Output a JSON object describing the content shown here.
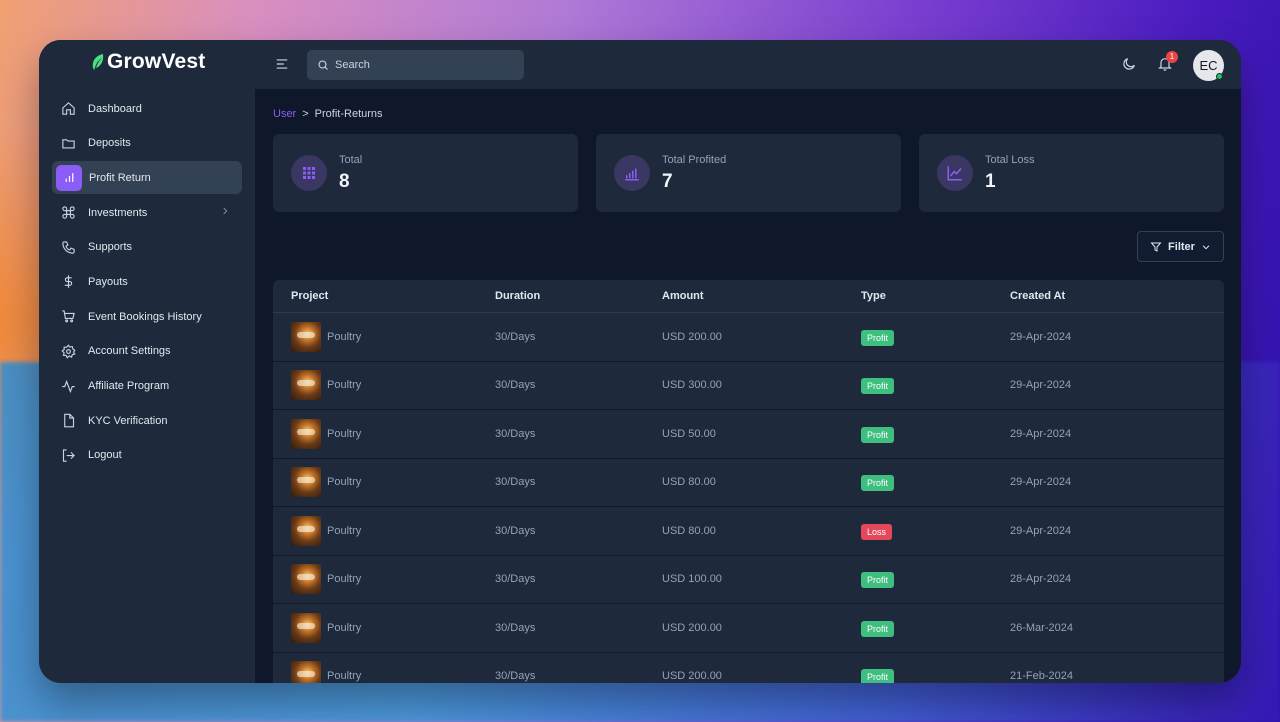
{
  "brand": {
    "name": "GrowVest"
  },
  "search": {
    "placeholder": "Search"
  },
  "header": {
    "notification_count": "1",
    "avatar_initials": "EC"
  },
  "sidebar": {
    "items": [
      {
        "label": "Dashboard",
        "icon": "home-icon"
      },
      {
        "label": "Deposits",
        "icon": "folder-icon"
      },
      {
        "label": "Profit Return",
        "icon": "bar-chart-icon",
        "active": true
      },
      {
        "label": "Investments",
        "icon": "command-icon",
        "has_children": true
      },
      {
        "label": "Supports",
        "icon": "phone-icon"
      },
      {
        "label": "Payouts",
        "icon": "dollar-icon"
      },
      {
        "label": "Event Bookings History",
        "icon": "cart-icon"
      },
      {
        "label": "Account Settings",
        "icon": "gear-icon"
      },
      {
        "label": "Affiliate Program",
        "icon": "activity-icon"
      },
      {
        "label": "KYC Verification",
        "icon": "file-icon"
      },
      {
        "label": "Logout",
        "icon": "logout-icon"
      }
    ]
  },
  "breadcrumb": {
    "parent": "User",
    "separator": ">",
    "current": "Profit-Returns"
  },
  "stats": [
    {
      "label": "Total",
      "value": "8",
      "icon": "grid-icon"
    },
    {
      "label": "Total Profited",
      "value": "7",
      "icon": "bar-chart-icon"
    },
    {
      "label": "Total Loss",
      "value": "1",
      "icon": "line-chart-icon"
    }
  ],
  "filter": {
    "label": "Filter"
  },
  "table": {
    "columns": [
      "Project",
      "Duration",
      "Amount",
      "Type",
      "Created At"
    ],
    "rows": [
      {
        "project": "Poultry",
        "duration": "30/Days",
        "amount": "USD 200.00",
        "type": "Profit",
        "created": "29-Apr-2024"
      },
      {
        "project": "Poultry",
        "duration": "30/Days",
        "amount": "USD 300.00",
        "type": "Profit",
        "created": "29-Apr-2024"
      },
      {
        "project": "Poultry",
        "duration": "30/Days",
        "amount": "USD 50.00",
        "type": "Profit",
        "created": "29-Apr-2024"
      },
      {
        "project": "Poultry",
        "duration": "30/Days",
        "amount": "USD 80.00",
        "type": "Profit",
        "created": "29-Apr-2024"
      },
      {
        "project": "Poultry",
        "duration": "30/Days",
        "amount": "USD 80.00",
        "type": "Loss",
        "created": "29-Apr-2024"
      },
      {
        "project": "Poultry",
        "duration": "30/Days",
        "amount": "USD 100.00",
        "type": "Profit",
        "created": "28-Apr-2024"
      },
      {
        "project": "Poultry",
        "duration": "30/Days",
        "amount": "USD 200.00",
        "type": "Profit",
        "created": "26-Mar-2024"
      },
      {
        "project": "Poultry",
        "duration": "30/Days",
        "amount": "USD 200.00",
        "type": "Profit",
        "created": "21-Feb-2024"
      }
    ]
  },
  "colors": {
    "accent": "#8b5cf6",
    "profit": "#3fbf7f",
    "loss": "#e5485b",
    "panel": "#1e293b",
    "background": "#0f172a"
  }
}
